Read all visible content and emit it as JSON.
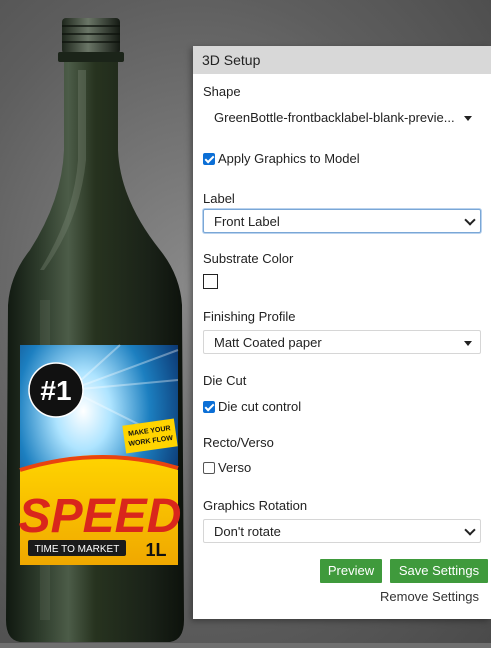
{
  "panel": {
    "title": "3D Setup",
    "shape": {
      "label": "Shape",
      "value": "GreenBottle-frontbacklabel-blank-previe..."
    },
    "apply_graphics": {
      "label": "Apply Graphics to Model",
      "checked": true
    },
    "label_field": {
      "label": "Label",
      "value": "Front Label"
    },
    "substrate_color": {
      "label": "Substrate Color",
      "color": "#ffffff"
    },
    "finishing_profile": {
      "label": "Finishing Profile",
      "value": "Matt Coated paper"
    },
    "die_cut": {
      "label": "Die Cut",
      "checkbox_label": "Die cut control",
      "checked": true
    },
    "recto_verso": {
      "label": "Recto/Verso",
      "checkbox_label": "Verso",
      "checked": false
    },
    "graphics_rotation": {
      "label": "Graphics Rotation",
      "value": "Don't rotate"
    },
    "buttons": {
      "preview": "Preview",
      "save": "Save Settings",
      "remove": "Remove Settings"
    }
  },
  "bottle_label": {
    "badge": "#1",
    "tagline_1": "MAKE YOUR",
    "tagline_2": "WORK FLOW",
    "headline": "SPEED",
    "subline": "TIME TO MARKET",
    "volume": "1L"
  },
  "colors": {
    "button_green": "#3f9a3c",
    "checkbox_blue": "#0b6fd6",
    "bottle_green": "#1f2a1e",
    "label_yellow": "#f5c400",
    "label_red": "#d9261c"
  }
}
